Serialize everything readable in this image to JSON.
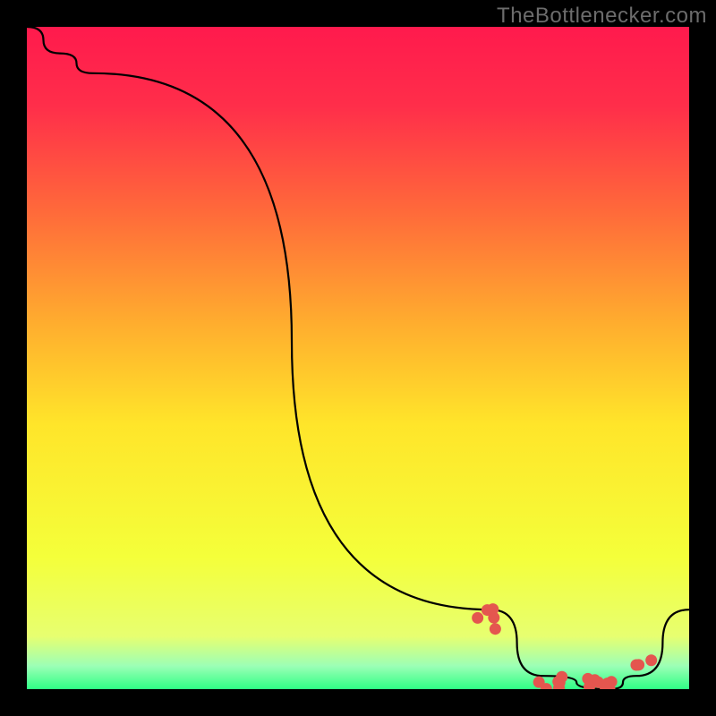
{
  "watermark": "TheBottlenecker.com",
  "chart_data": {
    "type": "line",
    "title": "",
    "xlabel": "",
    "ylabel": "",
    "xlim": [
      0,
      100
    ],
    "ylim": [
      0,
      100
    ],
    "grid": false,
    "legend": false,
    "series": [
      {
        "name": "curve",
        "x": [
          0,
          5,
          10,
          70,
          78,
          88,
          92,
          100
        ],
        "y": [
          100,
          96,
          93,
          12,
          2,
          0,
          2,
          12
        ]
      }
    ],
    "dot_clusters": [
      {
        "name": "cluster-left",
        "x_range": [
          68,
          72
        ],
        "y_range": [
          9,
          14
        ],
        "count": 5
      },
      {
        "name": "cluster-bottom",
        "x_range": [
          77,
          89
        ],
        "y_range": [
          0,
          2
        ],
        "count": 14
      },
      {
        "name": "cluster-right",
        "x_range": [
          92,
          95
        ],
        "y_range": [
          3,
          7
        ],
        "count": 3
      }
    ],
    "gradient_stops": [
      {
        "offset": 0.0,
        "color": "#ff1a4d"
      },
      {
        "offset": 0.12,
        "color": "#ff2e4a"
      },
      {
        "offset": 0.28,
        "color": "#ff6a3a"
      },
      {
        "offset": 0.45,
        "color": "#ffae2e"
      },
      {
        "offset": 0.6,
        "color": "#ffe52a"
      },
      {
        "offset": 0.8,
        "color": "#f4ff3a"
      },
      {
        "offset": 0.92,
        "color": "#e7ff70"
      },
      {
        "offset": 0.965,
        "color": "#9cffb6"
      },
      {
        "offset": 1.0,
        "color": "#2fff85"
      }
    ],
    "dot_color": "#e4564f"
  }
}
